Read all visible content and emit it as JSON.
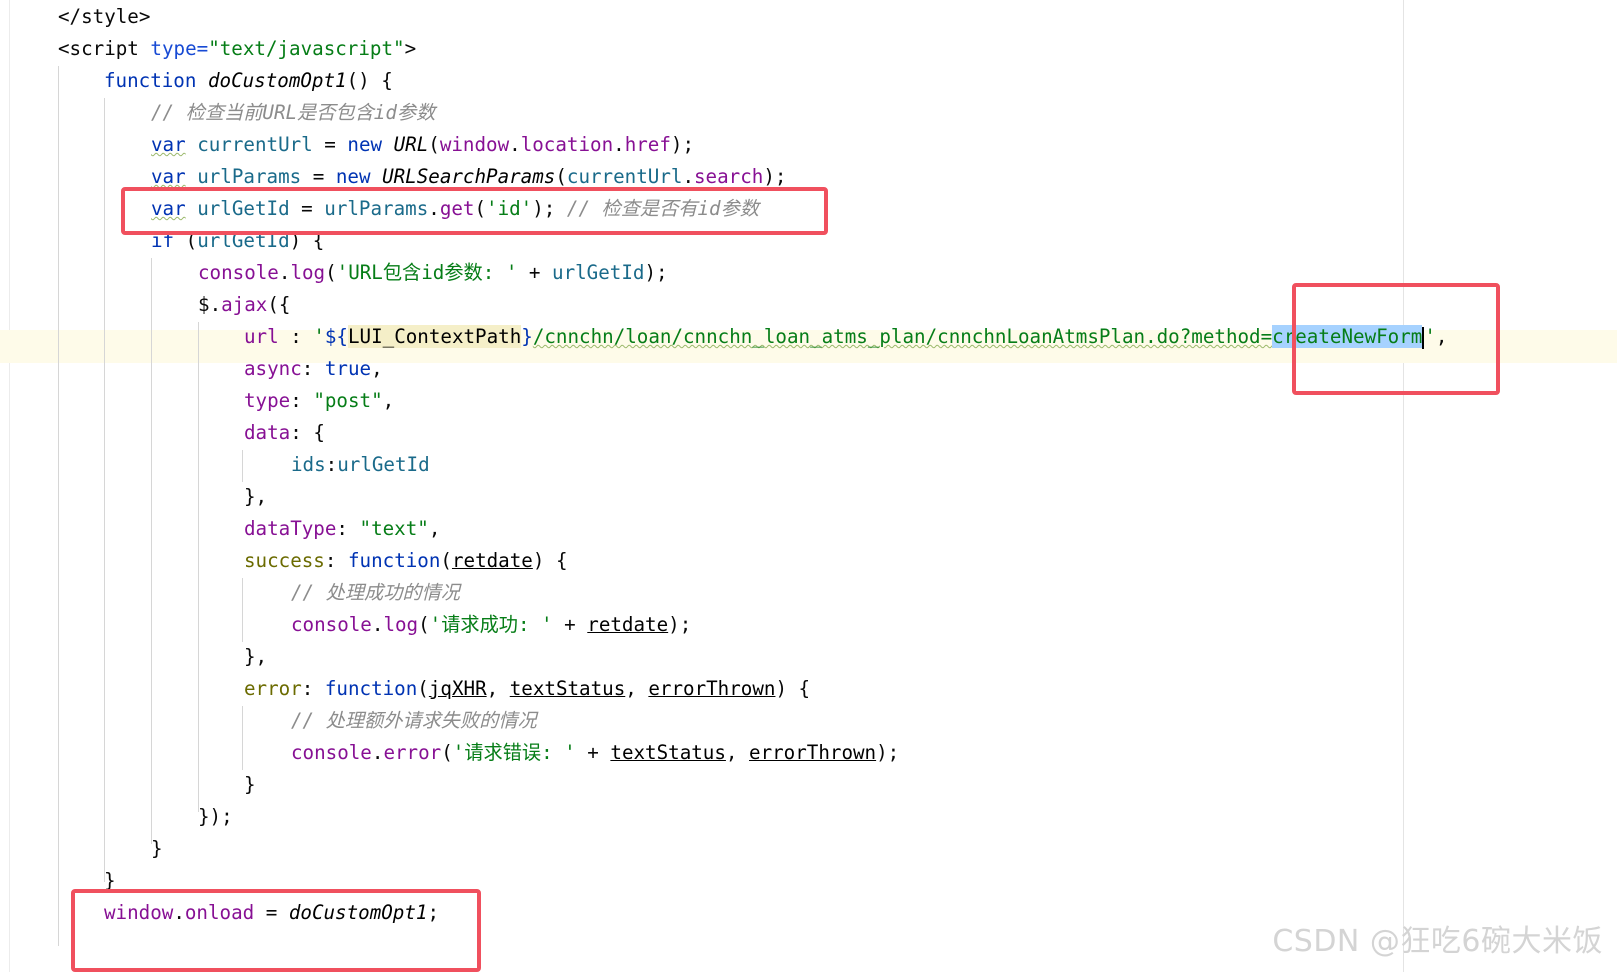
{
  "code": {
    "l1": "</style>",
    "l2_open": "<script ",
    "l2_attr": "type=",
    "l2_val": "\"text/javascript\"",
    "l2_close": ">",
    "l3_kw": "function ",
    "l3_name": "doCustomOpt1",
    "l3_rest": "() {",
    "l4": "// 检查当前URL是否包含id参数",
    "l5_kw": "var",
    "l5_var": " currentUrl",
    "l5_eq": " = ",
    "l5_new": "new ",
    "l5_cls": "URL",
    "l5_p1": "(",
    "l5_win": "window",
    "l5_dot": ".",
    "l5_loc": "location",
    "l5_dot2": ".",
    "l5_href": "href",
    "l5_end": ");",
    "l6_kw": "var",
    "l6_var": " urlParams",
    "l6_eq": " = ",
    "l6_new": "new ",
    "l6_cls": "URLSearchParams",
    "l6_p1": "(",
    "l6_arg": "currentUrl",
    "l6_dot": ".",
    "l6_search": "search",
    "l6_end": ");",
    "l7_kw": "var",
    "l7_var": " urlGetId",
    "l7_eq": " = ",
    "l7_obj": "urlParams",
    "l7_dot": ".",
    "l7_get": "get",
    "l7_p": "(",
    "l7_str": "'id'",
    "l7_end": "); ",
    "l7_cmt": "// 检查是否有id参数",
    "l8_kw": "if",
    "l8_p": " (",
    "l8_var": "urlGetId",
    "l8_end": ") {",
    "l9_obj": "console",
    "l9_dot": ".",
    "l9_fn": "log",
    "l9_p": "(",
    "l9_str": "'URL包含id参数: '",
    "l9_plus": " + ",
    "l9_var": "urlGetId",
    "l9_end": ");",
    "l10_obj": "$",
    "l10_dot": ".",
    "l10_fn": "ajax",
    "l10_end": "({",
    "l11_key": "url",
    "l11_sep": " : ",
    "l11_q": "'",
    "l11_tpl_open": "${",
    "l11_tpl": "LUI_ContextPath",
    "l11_tpl_close": "}",
    "l11_path": "/cnnchn/loan/cnnchn_loan_atms_plan/cnnchnLoanAtmsPlan.do?method=",
    "l11_sel": "createNewForm",
    "l11_q2": "'",
    "l11_end": ",",
    "l12_key": "async",
    "l12_sep": ": ",
    "l12_val": "true",
    "l12_end": ",",
    "l13_key": "type",
    "l13_sep": ": ",
    "l13_val": "\"post\"",
    "l13_end": ",",
    "l14_key": "data",
    "l14_sep": ": {",
    "l15_key": "ids",
    "l15_sep": ":",
    "l15_val": "urlGetId",
    "l16": "},",
    "l17_key": "dataType",
    "l17_sep": ": ",
    "l17_val": "\"text\"",
    "l17_end": ",",
    "l18_key": "success",
    "l18_sep": ": ",
    "l18_kw": "function",
    "l18_p": "(",
    "l18_param": "retdate",
    "l18_end": ") {",
    "l19": "// 处理成功的情况",
    "l20_obj": "console",
    "l20_dot": ".",
    "l20_fn": "log",
    "l20_p": "(",
    "l20_str": "'请求成功: '",
    "l20_plus": " + ",
    "l20_param": "retdate",
    "l20_end": ");",
    "l21": "},",
    "l22_key": "error",
    "l22_sep": ": ",
    "l22_kw": "function",
    "l22_p": "(",
    "l22_a1": "jqXHR",
    "l22_c1": ", ",
    "l22_a2": "textStatus",
    "l22_c2": ", ",
    "l22_a3": "errorThrown",
    "l22_end": ") {",
    "l23": "// 处理额外请求失败的情况",
    "l24_obj": "console",
    "l24_dot": ".",
    "l24_fn": "error",
    "l24_p": "(",
    "l24_str": "'请求错误: '",
    "l24_plus": " + ",
    "l24_a1": "textStatus",
    "l24_c": ", ",
    "l24_a2": "errorThrown",
    "l24_end": ");",
    "l25": "}",
    "l26": "});",
    "l27": "}",
    "l28": "}",
    "l29_obj": "window",
    "l29_dot": ".",
    "l29_prop": "onload",
    "l29_eq": " = ",
    "l29_fn": "doCustomOpt1",
    "l29_end": ";"
  },
  "watermark": "CSDN @狂吃6碗大米饭",
  "colors": {
    "highlight_box": "#f0505e",
    "keyword": "#0033b3",
    "string": "#067d17",
    "comment": "#8c8c8c",
    "selection": "#a6d2ff"
  }
}
